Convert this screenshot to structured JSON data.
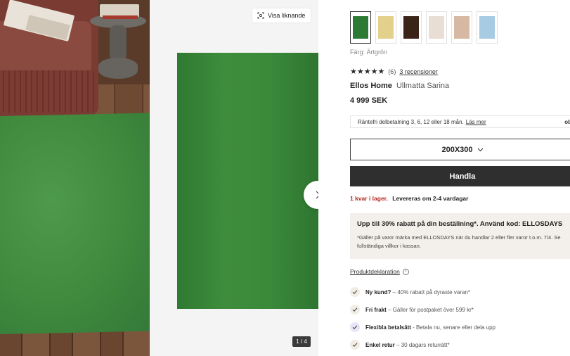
{
  "gallery": {
    "visa_liknande_label": "Visa liknande",
    "counter": "1 / 4"
  },
  "product": {
    "swatches": [
      {
        "name": "Ärtgrön",
        "color": "#2d7a34",
        "selected": true
      },
      {
        "name": "Gul",
        "color": "#e3d08b",
        "selected": false
      },
      {
        "name": "Brun",
        "color": "#3a2418",
        "selected": false
      },
      {
        "name": "Beige",
        "color": "#e8ded3",
        "selected": false
      },
      {
        "name": "Rosa",
        "color": "#d6b8a3",
        "selected": false
      },
      {
        "name": "Blå",
        "color": "#a6cbe3",
        "selected": false
      }
    ],
    "color_label": "Färg: Ärtgrön",
    "rating": {
      "stars": "★★★★★",
      "count": "(6)",
      "reviews_link": "3 recensioner"
    },
    "brand": "Ellos Home",
    "name": "Ullmatta Sarina",
    "price": "4 999 SEK",
    "installment": {
      "text": "Räntefri delbetalning 3, 6, 12 eller 18 mån.",
      "link": "Läs mer",
      "logo": "ob"
    },
    "size": "200X300",
    "buy_label": "Handla",
    "stock_low": "1 kvar i lager.",
    "delivery": "Levereras om 2-4 vardagar",
    "promo": {
      "headline": "Upp till 30% rabatt på din beställning*. Använd kod: ELLOSDAYS",
      "terms": "*Gäller på varor märka med ELLOSDAYS när du handlar 2 eller fler varor t.o.m. 7/4. Se fullständiga villkor i kassan."
    },
    "declaration_link": "Produktdeklaration",
    "usps": [
      {
        "title": "Ny kund?",
        "text": " – 40% rabatt på dyraste varan*",
        "icon_bg": "#f1ece4"
      },
      {
        "title": "Fri frakt",
        "text": " – Gäller för postpaket över 599 kr*",
        "icon_bg": "#f1ece4"
      },
      {
        "title": "Flexibla betalsätt",
        "text": " - Betala nu, senare eller dela upp",
        "icon_bg": "#e7e6f6"
      },
      {
        "title": "Enkel retur",
        "text": " – 30 dagars returrätt*",
        "icon_bg": "#f1ece4"
      }
    ]
  }
}
